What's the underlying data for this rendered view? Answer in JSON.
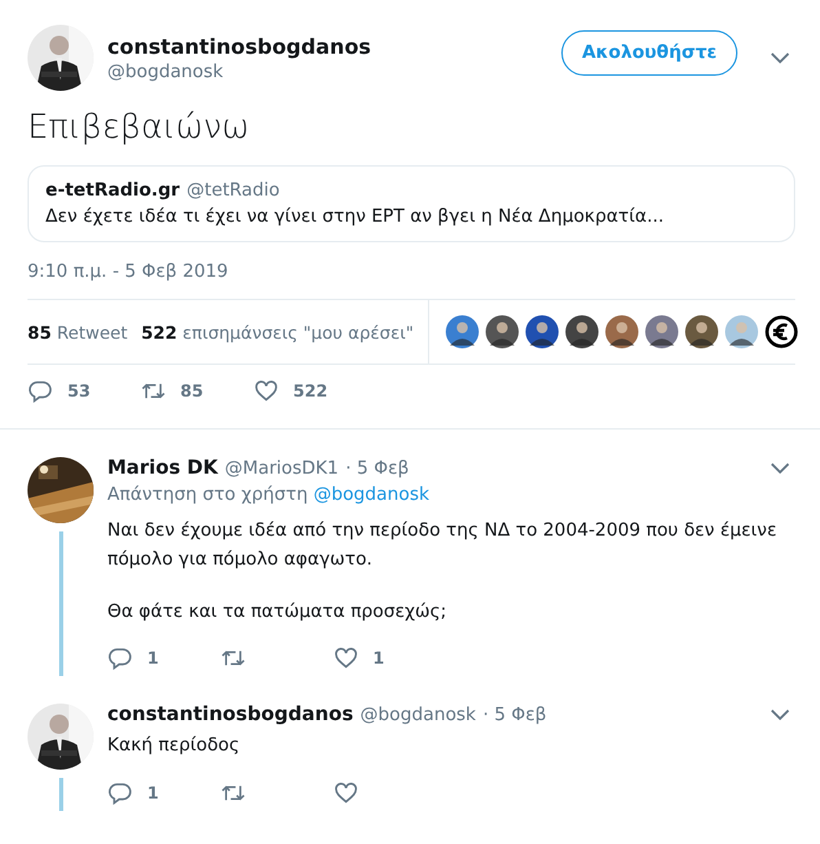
{
  "tweet": {
    "name": "constantinosbogdanos",
    "handle": "@bogdanosk",
    "follow_button": "Ακολουθήστε",
    "text": "Επιβεβαιώνω",
    "quote": {
      "name": "e-tetRadio.gr",
      "handle": "@tetRadio",
      "text": "Δεν έχετε ιδέα τι έχει να γίνει στην ΕΡΤ αν βγει η Νέα Δημοκρατία..."
    },
    "timestamp": "9:10 π.μ. - 5 Φεβ 2019",
    "stats": [
      {
        "count": "85",
        "label": "Retweet"
      },
      {
        "count": "522",
        "label": "επισημάνσεις \"μου αρέσει\""
      }
    ],
    "likers": [
      {
        "kind": "picture"
      },
      {
        "kind": "picture"
      },
      {
        "kind": "picture"
      },
      {
        "kind": "picture"
      },
      {
        "kind": "picture"
      },
      {
        "kind": "picture"
      },
      {
        "kind": "picture"
      },
      {
        "kind": "picture"
      },
      {
        "kind": "badge"
      }
    ],
    "actions": {
      "replies": "53",
      "retweets": "85",
      "likes": "522"
    }
  },
  "replies": [
    {
      "name": "Marios DK",
      "handle": "@MariosDK1",
      "date": "· 5 Φεβ",
      "reply_to_label": "Απάντηση στο χρήστη",
      "reply_to": "@bogdanosk",
      "paragraphs": [
        "Ναι δεν έχουμε ιδέα από την περίοδο της ΝΔ το 2004-2009 που δεν έμεινε πόμολο για πόμολο αφαγωτο.",
        "Θα φάτε και τα πατώματα προσεχώς;"
      ],
      "actions": {
        "replies": "1",
        "likes": "1"
      }
    },
    {
      "name": "constantinosbogdanos",
      "handle": "@bogdanosk",
      "date": "· 5 Φεβ",
      "paragraphs": [
        "Κακή περίοδος"
      ],
      "actions": {
        "replies": "1"
      }
    }
  ]
}
